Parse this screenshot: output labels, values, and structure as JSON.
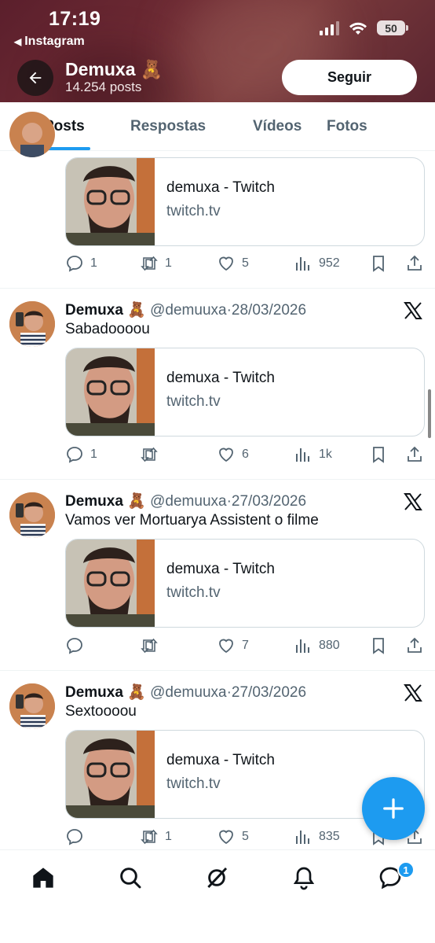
{
  "status_bar": {
    "time": "17:19",
    "back_app": "Instagram",
    "battery": "50"
  },
  "header": {
    "name": "Demuxa 🧸",
    "posts_count": "14.254 posts",
    "follow_label": "Seguir"
  },
  "tabs": [
    {
      "label": "Posts",
      "active": true
    },
    {
      "label": "Respostas",
      "active": false
    },
    {
      "label": "Vídeos",
      "active": false
    },
    {
      "label": "Fotos",
      "active": false
    }
  ],
  "tweets": [
    {
      "name": "",
      "handle": "",
      "date": "",
      "text": "",
      "card": {
        "title": "demuxa - Twitch",
        "domain": "twitch.tv"
      },
      "stats": {
        "replies": "1",
        "reposts": "1",
        "likes": "5",
        "views": "952"
      }
    },
    {
      "name": "Demuxa 🧸",
      "handle": "@demuuxa",
      "date": "28/03/2026",
      "text": "Sabadoooou",
      "card": {
        "title": "demuxa - Twitch",
        "domain": "twitch.tv"
      },
      "stats": {
        "replies": "1",
        "reposts": "",
        "likes": "6",
        "views": "1k"
      }
    },
    {
      "name": "Demuxa 🧸",
      "handle": "@demuuxa",
      "date": "27/03/2026",
      "text": "Vamos ver Mortuarya Assistent o filme",
      "card": {
        "title": "demuxa - Twitch",
        "domain": "twitch.tv"
      },
      "stats": {
        "replies": "",
        "reposts": "",
        "likes": "7",
        "views": "880"
      }
    },
    {
      "name": "Demuxa 🧸",
      "handle": "@demuuxa",
      "date": "27/03/2026",
      "text": "Sextoooou",
      "card": {
        "title": "demuxa - Twitch",
        "domain": "twitch.tv"
      },
      "stats": {
        "replies": "",
        "reposts": "1",
        "likes": "5",
        "views": "835"
      }
    }
  ],
  "bottom_nav": {
    "items": [
      "home-icon",
      "search-icon",
      "grok-icon",
      "notifications-icon",
      "messages-icon"
    ],
    "messages_badge": "1"
  },
  "colors": {
    "accent": "#1d9bf0",
    "text": "#0f1419",
    "muted": "#536471",
    "header_bg": "#6d2a33"
  }
}
